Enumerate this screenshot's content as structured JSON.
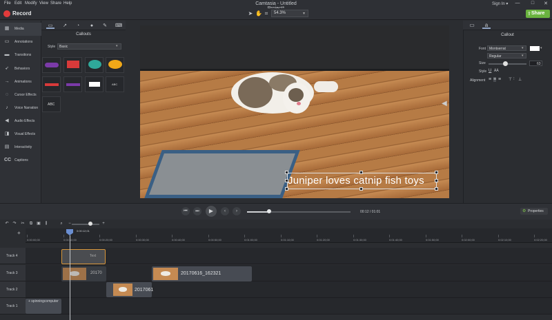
{
  "menubar": {
    "menus": [
      "File",
      "Edit",
      "Modify",
      "View",
      "Share",
      "Help"
    ],
    "title": "Camtasia - Untitled Project*",
    "sign_in": "Sign In ▾",
    "window_controls": [
      "—",
      "□",
      "✕"
    ]
  },
  "toolbar": {
    "record_label": "Record",
    "zoom_value": "54.3%",
    "share_label": "Share",
    "tools": [
      "pointer-icon",
      "hand-icon",
      "crop-icon"
    ]
  },
  "leftnav": {
    "items": [
      {
        "label": "Media",
        "icon": "media-icon"
      },
      {
        "label": "Annotations",
        "icon": "annotations-icon"
      },
      {
        "label": "Transitions",
        "icon": "transitions-icon"
      },
      {
        "label": "Behaviors",
        "icon": "behaviors-icon"
      },
      {
        "label": "Animations",
        "icon": "animations-icon"
      },
      {
        "label": "Cursor Effects",
        "icon": "cursor-effects-icon"
      },
      {
        "label": "Voice Narration",
        "icon": "voice-narration-icon"
      },
      {
        "label": "Audio Effects",
        "icon": "audio-effects-icon"
      },
      {
        "label": "Visual Effects",
        "icon": "visual-effects-icon"
      },
      {
        "label": "Interactivity",
        "icon": "interactivity-icon"
      },
      {
        "label": "Captions",
        "icon": "captions-icon"
      }
    ]
  },
  "panel": {
    "title": "Callouts",
    "style_label": "Style",
    "style_value": "Basic",
    "thumb_labels": {
      "abc_plain": "ABC",
      "abc_large": "ABC"
    }
  },
  "canvas": {
    "caption": "Juniper loves catnip fish toys"
  },
  "properties": {
    "title": "Callout",
    "font_label": "Font",
    "font_value": "Montserrat",
    "weight_value": "Regular",
    "size_label": "Size",
    "size_value": "63",
    "style_label": "Style",
    "alignment_label": "Alignment",
    "button_label": "Properties"
  },
  "playback": {
    "time": "00:12  /  01:01"
  },
  "timeline": {
    "playhead_time": "0:00:12;01",
    "ticks": [
      "0:00:00;00",
      "0:00:10;00",
      "0:00:20;00",
      "0:00:30;00",
      "0:00:40;00",
      "0:00:50;00",
      "0:01:00;00",
      "0:01:10;00",
      "0:01:20;00",
      "0:01:30;00",
      "0:01:40;00",
      "0:01:50;00",
      "0:02:00;00",
      "0:02:10;00",
      "0:02:20;00"
    ],
    "tracks": [
      "Track 4",
      "Track 3",
      "Track 2",
      "Track 1"
    ],
    "clips": {
      "text": "Text",
      "t3a": "20170",
      "t3b": "20170616_162321",
      "t2": "2017061",
      "t1": "+ spinningcomputer"
    }
  },
  "colors": {
    "share_green": "#6ab33f",
    "record_red": "#e23b3b",
    "selected_clip_border": "#d8963a",
    "playhead_blue": "#6a8ed1"
  }
}
